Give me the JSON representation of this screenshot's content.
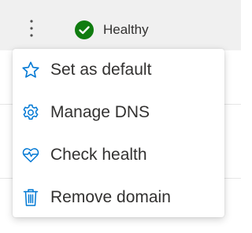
{
  "header": {
    "status_label": "Healthy",
    "status_color": "#107c10",
    "more_icon": "more-vertical-icon"
  },
  "menu": {
    "accent_color": "#0078d4",
    "items": [
      {
        "label": "Set as default",
        "icon": "star-icon"
      },
      {
        "label": "Manage DNS",
        "icon": "gear-icon"
      },
      {
        "label": "Check health",
        "icon": "heart-pulse-icon"
      },
      {
        "label": "Remove domain",
        "icon": "trash-icon"
      }
    ]
  }
}
